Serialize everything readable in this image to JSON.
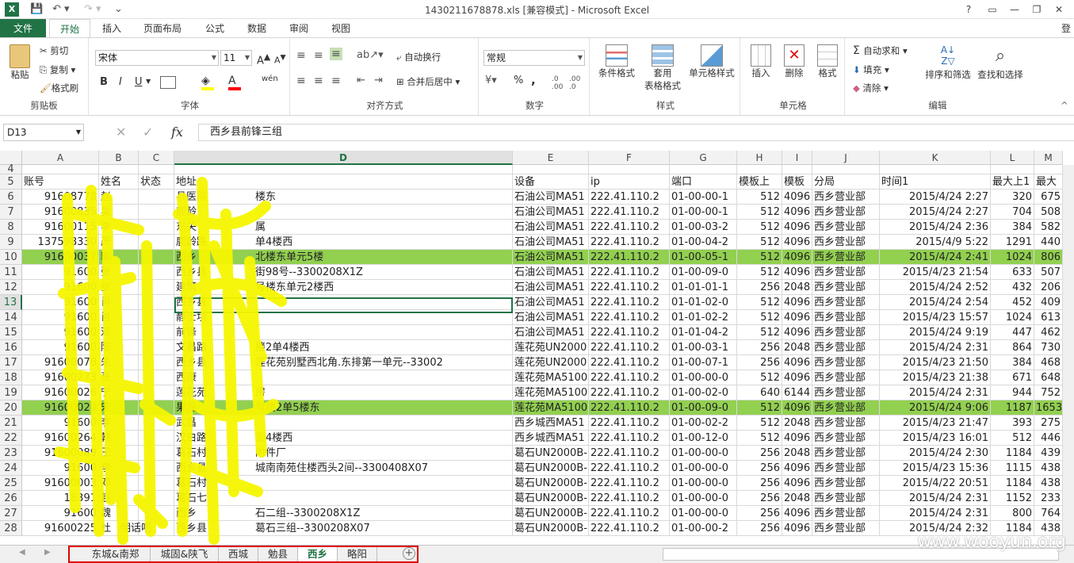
{
  "window": {
    "title": "1430211678878.xls  [兼容模式] - Microsoft Excel",
    "login_label": "登",
    "controls": [
      "?",
      "▭",
      "—",
      "❐",
      "✕"
    ]
  },
  "ribbon_tabs": [
    "文件",
    "开始",
    "插入",
    "页面布局",
    "公式",
    "数据",
    "审阅",
    "视图"
  ],
  "ribbon": {
    "clipboard": {
      "paste": "粘贴",
      "cut": "剪切",
      "copy": "复制",
      "format_painter": "格式刷",
      "label": "剪贴板"
    },
    "font": {
      "name": "宋体",
      "size": "11",
      "label": "字体",
      "bold": "B",
      "italic": "I",
      "underline": "U",
      "wen": "wén"
    },
    "alignment": {
      "wrap": "自动换行",
      "merge": "合并后居中",
      "label": "对齐方式"
    },
    "number": {
      "format": "常规",
      "label": "数字",
      "percent": "%",
      "comma": ","
    },
    "styles": {
      "conditional": "条件格式",
      "table1": "套用",
      "table2": "表格格式",
      "cell_styles": "单元格样式",
      "label": "样式"
    },
    "cells": {
      "insert": "插入",
      "delete": "删除",
      "format": "格式",
      "label": "单元格"
    },
    "editing": {
      "autosum": "自动求和",
      "fill": "填充",
      "clear": "清除",
      "sort": "排序和筛选",
      "find": "查找和选择",
      "label": "编辑"
    }
  },
  "formula_bar": {
    "name_box": "D13",
    "fx": "fx",
    "content": "西乡县前锋三组"
  },
  "columns": [
    "A",
    "B",
    "C",
    "D",
    "E",
    "F",
    "G",
    "H",
    "I",
    "J",
    "K",
    "L",
    "M"
  ],
  "rows": [
    {
      "n": "4",
      "cells": [
        "",
        "",
        "",
        "",
        "",
        "",
        "",
        "",
        "",
        "",
        "",
        "",
        ""
      ]
    },
    {
      "n": "5",
      "cells": [
        "账号",
        "姓名",
        "状态",
        "地址",
        "设备",
        "ip",
        "端口",
        "模板上",
        "模板",
        "分局",
        "时间1",
        "最大上1",
        "最大"
      ]
    },
    {
      "n": "6",
      "cells": [
        "91608778",
        "赵",
        "",
        "县医院",
        "石油公司MA51",
        "222.41.110.2",
        "01-00-00-1",
        "512",
        "4096",
        "西乡营业部",
        "2015/4/24 2:27",
        "320",
        "675"
      ]
    },
    {
      "n": "7",
      "cells": [
        "91600835",
        "吴",
        "",
        "鹿龄",
        "石油公司MA51",
        "222.41.110.2",
        "01-00-00-1",
        "512",
        "4096",
        "西乡营业部",
        "2015/4/24 2:27",
        "704",
        "508"
      ]
    },
    {
      "n": "8",
      "cells": [
        "91600115",
        "李",
        "",
        "东关",
        "石油公司MA51",
        "222.41.110.2",
        "01-00-03-2",
        "512",
        "4096",
        "西乡营业部",
        "2015/4/24 2:36",
        "384",
        "582"
      ]
    },
    {
      "n": "9",
      "cells": [
        "137598330",
        "严",
        "",
        "鹿龄路",
        "石油公司MA51",
        "222.41.110.2",
        "01-00-04-2",
        "512",
        "4096",
        "西乡营业部",
        "2015/4/9 5:22",
        "1291",
        "440"
      ]
    },
    {
      "n": "10",
      "cells": [
        "91600037",
        "郭",
        "",
        "西乡",
        "石油公司MA51",
        "222.41.110.2",
        "01-00-05-1",
        "512",
        "4096",
        "西乡营业部",
        "2015/4/24 2:41",
        "1024",
        "806"
      ],
      "hl": true
    },
    {
      "n": "11",
      "cells": [
        "91600",
        "张",
        "",
        "西乡县",
        "石油公司MA51",
        "222.41.110.2",
        "01-00-09-0",
        "512",
        "4096",
        "西乡营业部",
        "2015/4/23 21:54",
        "633",
        "507"
      ]
    },
    {
      "n": "12",
      "cells": [
        "91600",
        "张",
        "",
        "建筑",
        "石油公司MA51",
        "222.41.110.2",
        "01-01-01-1",
        "256",
        "2048",
        "西乡营业部",
        "2015/4/24 2:52",
        "432",
        "206"
      ]
    },
    {
      "n": "13",
      "cells": [
        "91600",
        "肖",
        "",
        "西乡县",
        "石油公司MA51",
        "222.41.110.2",
        "01-01-02-0",
        "512",
        "4096",
        "西乡营业部",
        "2015/4/24 2:54",
        "452",
        "409"
      ]
    },
    {
      "n": "14",
      "cells": [
        "91600",
        "肖",
        "",
        "静士坝",
        "石油公司MA51",
        "222.41.110.2",
        "01-01-02-2",
        "512",
        "4096",
        "西乡营业部",
        "2015/4/23 15:57",
        "1024",
        "613"
      ]
    },
    {
      "n": "15",
      "cells": [
        "91600",
        "邓",
        "",
        "前锋",
        "石油公司MA51",
        "222.41.110.2",
        "01-01-04-2",
        "512",
        "4096",
        "西乡营业部",
        "2015/4/24 9:19",
        "447",
        "462"
      ]
    },
    {
      "n": "16",
      "cells": [
        "91600",
        "陈",
        "",
        "文昌路",
        "莲花苑UN2000",
        "222.41.110.2",
        "01-00-03-1",
        "256",
        "2048",
        "西乡营业部",
        "2015/4/24 2:31",
        "864",
        "730"
      ]
    },
    {
      "n": "17",
      "cells": [
        "91600078",
        "朱",
        "",
        "西乡县",
        "莲花苑UN2000",
        "222.41.110.2",
        "01-00-07-1",
        "256",
        "4096",
        "西乡营业部",
        "2015/4/23 21:50",
        "384",
        "468"
      ]
    },
    {
      "n": "18",
      "cells": [
        "91600273",
        "张",
        "",
        "西康",
        "莲花苑MA5100",
        "222.41.110.2",
        "01-00-00-0",
        "512",
        "4096",
        "西乡营业部",
        "2015/4/23 21:38",
        "671",
        "648"
      ]
    },
    {
      "n": "19",
      "cells": [
        "91600026",
        "宁",
        "",
        "莲花苑",
        "莲花苑MA5100",
        "222.41.110.2",
        "01-00-02-0",
        "640",
        "6144",
        "西乡营业部",
        "2015/4/24 2:31",
        "944",
        "752"
      ]
    },
    {
      "n": "20",
      "cells": [
        "91600020",
        "宋",
        "",
        "果品",
        "莲花苑MA5100",
        "222.41.110.2",
        "01-00-09-0",
        "512",
        "4096",
        "西乡营业部",
        "2015/4/24 9:06",
        "1187",
        "1653"
      ],
      "hl": true
    },
    {
      "n": "21",
      "cells": [
        "91600",
        "李",
        "",
        "武昌",
        "西乡城西MA51",
        "222.41.110.2",
        "01-00-02-2",
        "512",
        "2048",
        "西乡营业部",
        "2015/4/23 21:47",
        "393",
        "275"
      ]
    },
    {
      "n": "22",
      "cells": [
        "91600264",
        "韩",
        "",
        "汉白路",
        "西乡城西MA51",
        "222.41.110.2",
        "01-00-12-0",
        "512",
        "4096",
        "西乡营业部",
        "2015/4/23 16:01",
        "512",
        "446"
      ]
    },
    {
      "n": "23",
      "cells": [
        "91600089",
        "王",
        "",
        "葛石村",
        "葛石UN2000B-",
        "222.41.110.2",
        "01-00-00-0",
        "256",
        "2048",
        "西乡营业部",
        "2015/4/24 2:30",
        "1184",
        "439"
      ]
    },
    {
      "n": "24",
      "cells": [
        "91600",
        "李",
        "",
        "西乡县",
        "葛石UN2000B-",
        "222.41.110.2",
        "01-00-00-0",
        "256",
        "4096",
        "西乡营业部",
        "2015/4/23 15:36",
        "1115",
        "438"
      ]
    },
    {
      "n": "25",
      "cells": [
        "91600003",
        "邓",
        "",
        "葛石村",
        "葛石UN2000B-",
        "222.41.110.2",
        "01-00-00-0",
        "256",
        "4096",
        "西乡营业部",
        "2015/4/22 20:51",
        "1184",
        "438"
      ]
    },
    {
      "n": "26",
      "cells": [
        "18391",
        "赵",
        "",
        "葛石七",
        "葛石UN2000B-",
        "222.41.110.2",
        "01-00-00-0",
        "256",
        "2048",
        "西乡营业部",
        "2015/4/24 2:31",
        "1152",
        "233"
      ]
    },
    {
      "n": "27",
      "cells": [
        "91600",
        "魏",
        "",
        "西乡",
        "葛石UN2000B-",
        "222.41.110.2",
        "01-00-00-0",
        "256",
        "4096",
        "西乡营业部",
        "2015/4/24 2:31",
        "800",
        "764"
      ]
    },
    {
      "n": "28",
      "cells": [
        "91600225",
        "杜",
        "",
        "西乡县",
        "葛石UN2000B-",
        "222.41.110.2",
        "01-00-00-2",
        "256",
        "4096",
        "西乡营业部",
        "2015/4/24 2:32",
        "1184",
        "438"
      ]
    }
  ],
  "row_extras": {
    "r6": "楼东",
    "r8": "属",
    "r9": "单4楼西",
    "r10": "北楼东单元5楼",
    "r11": "街98号--3300208X1Z",
    "r12": "号楼东单元2楼西",
    "r16": "楼2单4楼西",
    "r17": "莲花苑别墅西北角.东排第一单元--33002",
    "r18": "",
    "r19": "房",
    "r20": "号楼2单5楼东",
    "r22": "面4楼西",
    "r23": "附件厂",
    "r24": "城南南苑住楼西头2间--3300408X07",
    "r27": "石二组--3300208X1Z",
    "r28": "葛石三组--3300208X07",
    "r28b": "明话吧"
  },
  "sheet_tabs": [
    "东城&南郑",
    "城固&陕飞",
    "西城",
    "勉县",
    "西乡",
    "略阳"
  ],
  "active_sheet": "西乡",
  "watermark": "www.wooyun.org"
}
